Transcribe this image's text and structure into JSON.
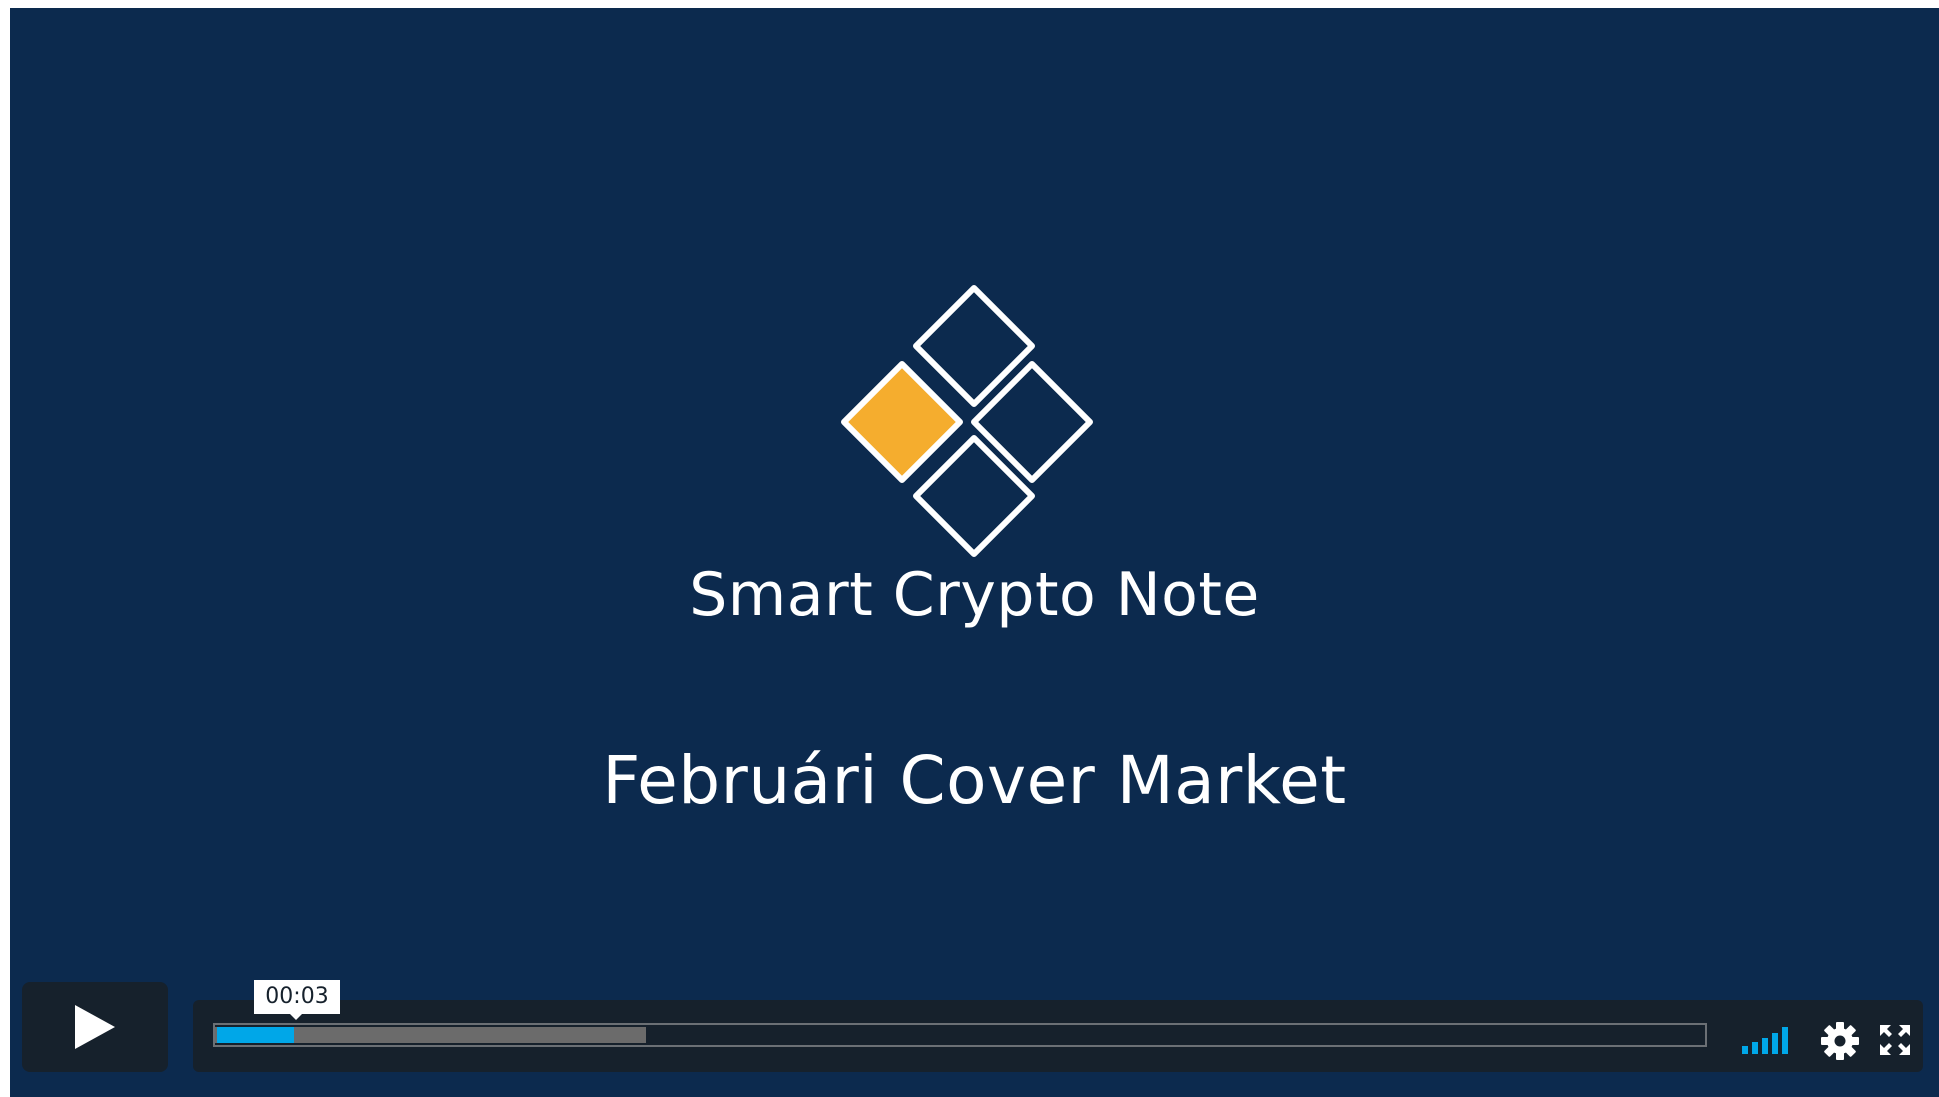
{
  "video": {
    "brand_name": "Smart Crypto Note",
    "title": "Februári Cover Market"
  },
  "controls": {
    "play_icon": "play-icon",
    "time_tooltip": "00:03",
    "progress_played_fraction": 0.052,
    "progress_buffered_fraction": 0.289,
    "volume_icon": "volume-bars-icon",
    "settings_icon": "gear-icon",
    "fullscreen_icon": "fullscreen-icon"
  },
  "colors": {
    "background": "#0c2a4e",
    "logo_accent": "#f5ad2e",
    "progress_played": "#00a7e8",
    "progress_buffered": "#6b6b6b",
    "control_bar": "#16212c",
    "volume_icon": "#00a7e8"
  }
}
